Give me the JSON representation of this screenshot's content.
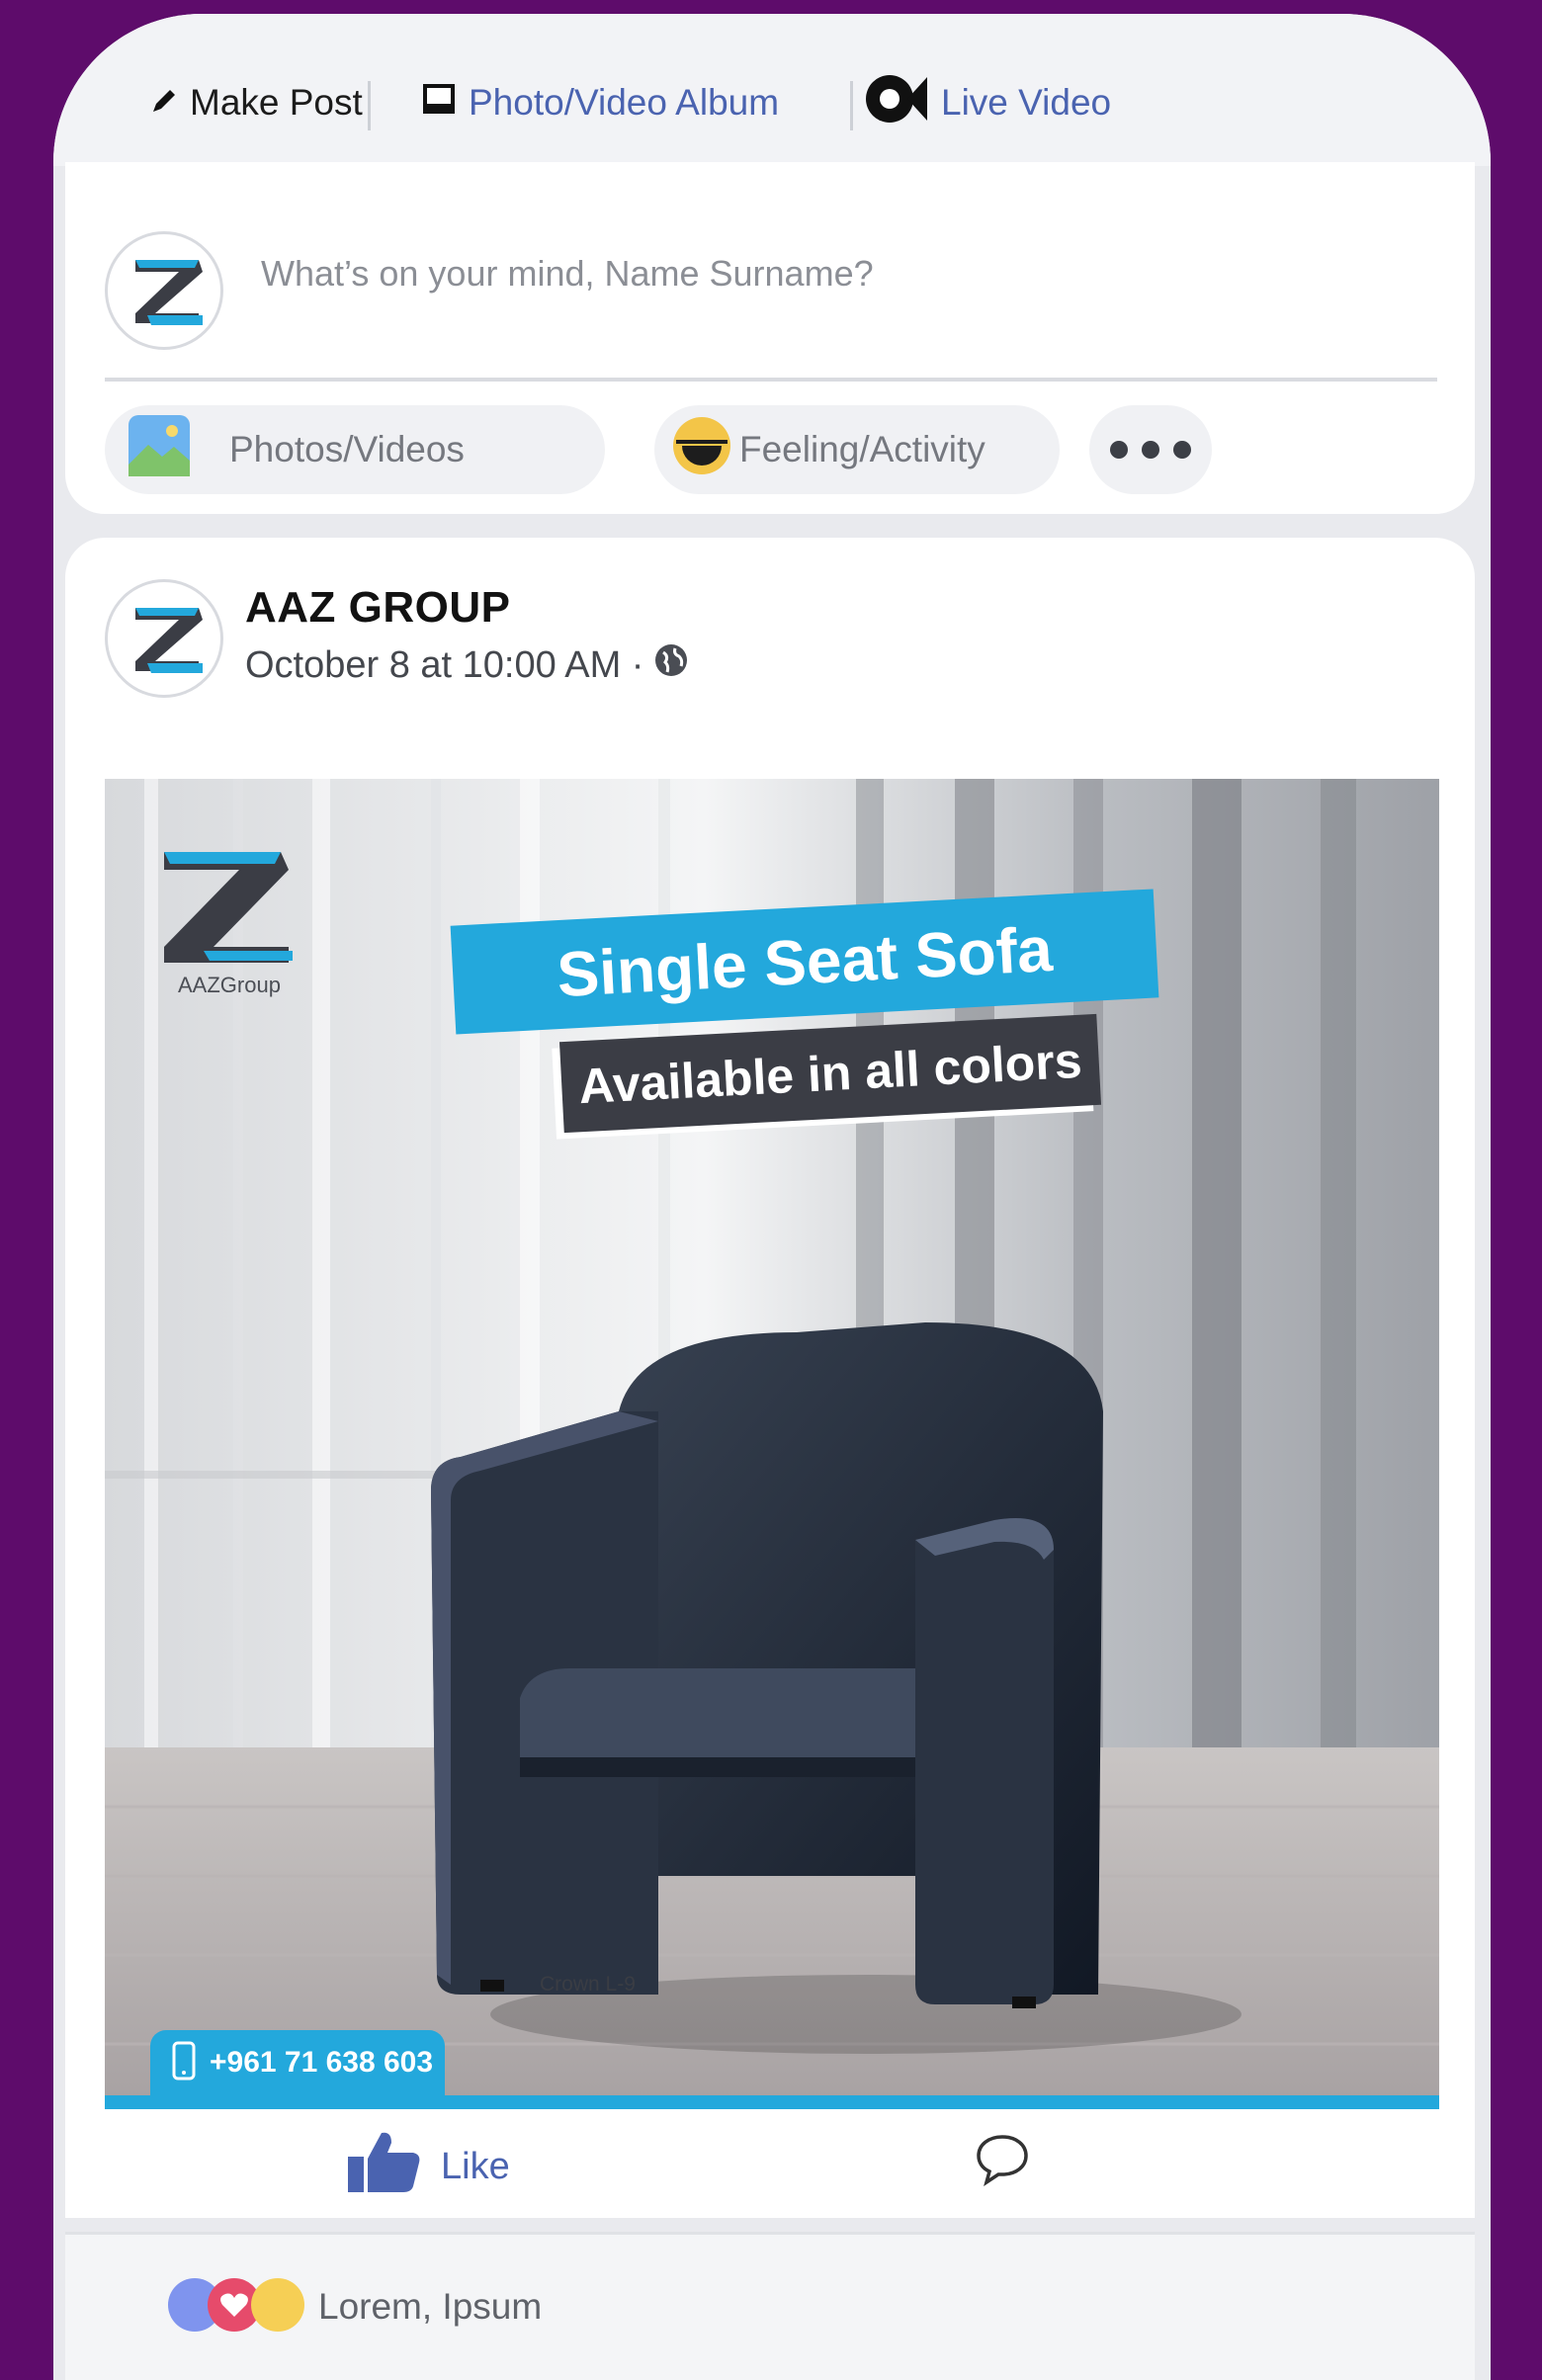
{
  "top_bar": {
    "make_post": "Make Post",
    "photo_album": "Photo/Video Album",
    "live_video": "Live Video"
  },
  "composer": {
    "placeholder": "What’s on your mind, Name Surname?",
    "photos_label": "Photos/Videos",
    "feeling_label": "Feeling/Activity"
  },
  "post": {
    "author": "AAZ GROUP",
    "timestamp": "October 8 at 10:00 AM ·",
    "image": {
      "title": "Single Seat Sofa",
      "subtitle": "Available in all colors",
      "brand": "AAZGroup",
      "model": "Crown L-9",
      "phone": "+961 71 638 603"
    },
    "like_label": "Like"
  },
  "reactions": {
    "text": "Lorem, Ipsum"
  },
  "colors": {
    "background": "#5e0c6b",
    "accent": "#23a8dc",
    "link": "#4a63b0"
  }
}
